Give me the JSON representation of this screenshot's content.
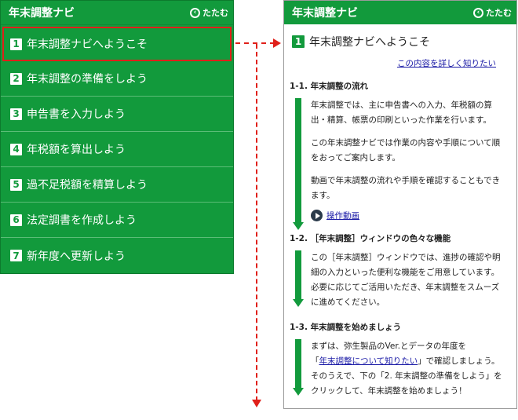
{
  "left_panel": {
    "title": "年末調整ナビ",
    "collapse_label": "たたむ",
    "items": [
      {
        "num": "1",
        "label": "年末調整ナビへようこそ"
      },
      {
        "num": "2",
        "label": "年末調整の準備をしよう"
      },
      {
        "num": "3",
        "label": "申告書を入力しよう"
      },
      {
        "num": "4",
        "label": "年税額を算出しよう"
      },
      {
        "num": "5",
        "label": "過不足税額を精算しよう"
      },
      {
        "num": "6",
        "label": "法定調書を作成しよう"
      },
      {
        "num": "7",
        "label": "新年度へ更新しよう"
      }
    ]
  },
  "right_panel": {
    "title": "年末調整ナビ",
    "collapse_label": "たたむ",
    "page_num": "1",
    "page_title": "年末調整ナビへようこそ",
    "detail_link": "この内容を詳しく知りたい",
    "sections": [
      {
        "heading": "1-1. 年末調整の流れ",
        "paragraphs": [
          "年末調整では、主に申告書への入力、年税額の算出・精算、帳票の印刷といった作業を行います。",
          "この年末調整ナビでは作業の内容や手順について順をおってご案内します。",
          "動画で年末調整の流れや手順を確認することもできます。"
        ],
        "video_link": "操作動画"
      },
      {
        "heading": "1-2. ［年末調整］ウィンドウの色々な機能",
        "paragraphs": [
          "この［年末調整］ウィンドウでは、進捗の確認や明細の入力といった便利な機能をご用意しています。必要に応じてご活用いただき、年末調整をスムーズに進めてください。"
        ]
      },
      {
        "heading": "1-3. 年末調整を始めましょう",
        "p1": "まずは、弥生製品のVer.とデータの年度を",
        "p1_open": "「",
        "p1_link": "年末調整について知りたい",
        "p1_close": "」で確認しましょう。",
        "p2": "そのうえで、下の「2. 年末調整の準備をしよう」をクリックして、年末調整を始めましょう！"
      }
    ]
  },
  "colors": {
    "accent": "#129a3c",
    "highlight": "#e0201a",
    "link": "#1a1aa6"
  }
}
